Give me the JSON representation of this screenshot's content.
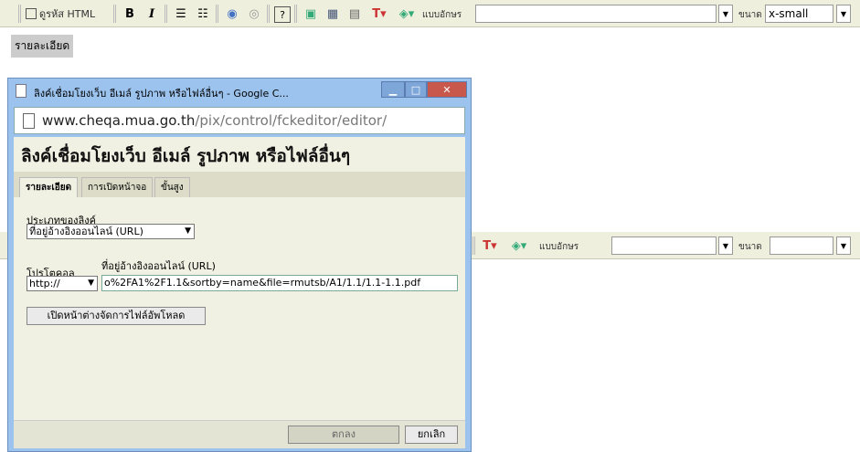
{
  "toolbar_top": {
    "source_label": "ดูรหัส HTML",
    "bold_label": "B",
    "italic_label": "I",
    "font_label": "แบบอักษร",
    "size_label": "ขนาด",
    "size_value": "x-small"
  },
  "toolbar_mid": {
    "font_label": "แบบอักษร",
    "size_label": "ขนาด"
  },
  "editor": {
    "detail_text": "รายละเอียด"
  },
  "popup": {
    "window_title": "ลิงค์เชื่อมโยงเว็บ อีเมล์ รูปภาพ หรือไฟล์อื่นๆ - Google C...",
    "url_host": "www.cheqa.mua.go.th",
    "url_path": "/pix/control/fckeditor/editor/",
    "dialog_title": "ลิงค์เชื่อมโยงเว็บ อีเมล์ รูปภาพ หรือไฟล์อื่นๆ",
    "tabs": [
      {
        "label": "รายละเอียด"
      },
      {
        "label": "การเปิดหน้าจอ"
      },
      {
        "label": "ขั้นสูง"
      }
    ],
    "link_type_label": "ประเภทของลิงค์",
    "link_type_value": "ที่อยู่อ้างอิงออนไลน์ (URL)",
    "protocol_label": "โปรโตคอล",
    "protocol_value": "http://",
    "url_label": "ที่อยู่อ้างอิงออนไลน์ (URL)",
    "url_value": "o%2FA1%2F1.1&sortby=name&file=rmutsb/A1/1.1/1.1-1.1.pdf",
    "browse_button": "เปิดหน้าต่างจัดการไฟล์อัพโหลด",
    "ok_button": "ตกลง",
    "cancel_button": "ยกเลิก"
  }
}
